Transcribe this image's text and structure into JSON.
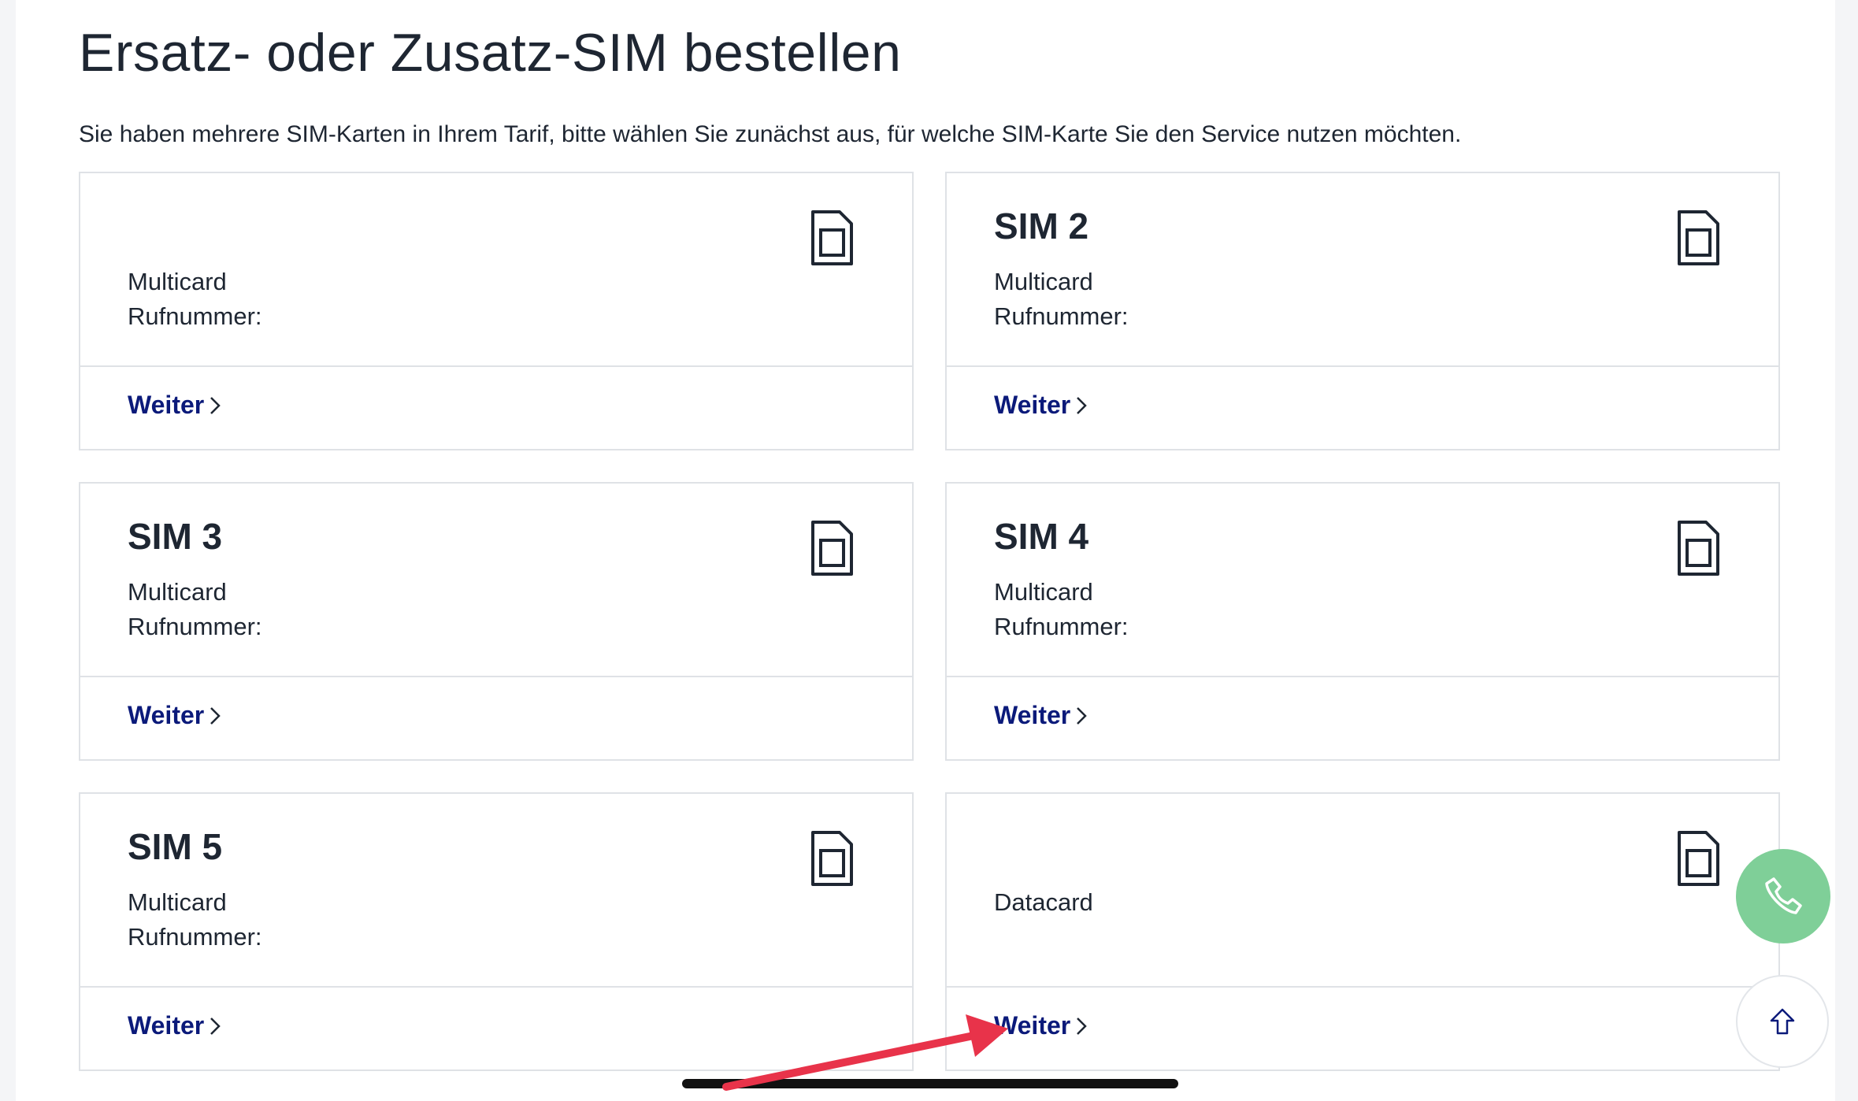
{
  "page": {
    "title": "Ersatz- oder Zusatz-SIM bestellen",
    "intro": "Sie haben mehrere SIM-Karten in Ihrem Tarif, bitte wählen Sie zunächst aus, für welche SIM-Karte Sie den Service nutzen möchten."
  },
  "cards": [
    {
      "title": "",
      "type": "Multicard",
      "phone": "Rufnummer:",
      "link": "Weiter",
      "icon": "sim-card-icon"
    },
    {
      "title": "SIM 2",
      "type": "Multicard",
      "phone": "Rufnummer:",
      "link": "Weiter",
      "icon": "sim-card-icon"
    },
    {
      "title": "SIM 3",
      "type": "Multicard",
      "phone": "Rufnummer:",
      "link": "Weiter",
      "icon": "sim-card-icon"
    },
    {
      "title": "SIM 4",
      "type": "Multicard",
      "phone": "Rufnummer:",
      "link": "Weiter",
      "icon": "sim-card-icon"
    },
    {
      "title": "SIM 5",
      "type": "Multicard",
      "phone": "Rufnummer:",
      "link": "Weiter",
      "icon": "sim-card-icon"
    },
    {
      "title": "",
      "type": "Datacard",
      "phone": "",
      "link": "Weiter",
      "icon": "sim-card-icon"
    }
  ],
  "floating": {
    "call_icon": "phone-icon",
    "top_icon": "arrow-up-icon"
  },
  "colors": {
    "link": "#0b1a7a",
    "call_button": "#7fcf98",
    "annotation_arrow": "#e8334a"
  }
}
